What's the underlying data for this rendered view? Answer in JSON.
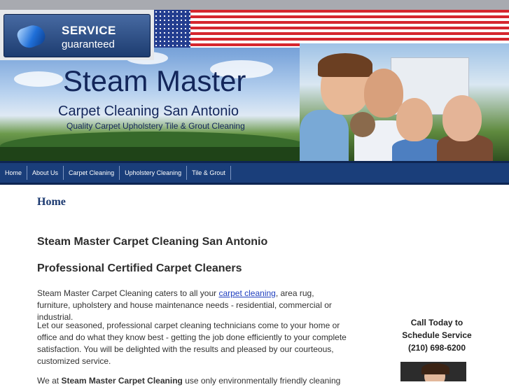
{
  "header": {
    "badge_line1": "SERVICE",
    "badge_line2": "guaranteed",
    "site_title": "Steam Master",
    "site_subtitle": "Carpet Cleaning San Antonio",
    "tagline": "Quality Carpet Upholstery Tile & Grout Cleaning"
  },
  "nav": {
    "items": [
      "Home",
      "About Us",
      "Carpet Cleaning",
      "Upholstery Cleaning",
      "Tile & Grout"
    ]
  },
  "main": {
    "page_heading": "Home",
    "heading1": "Steam Master Carpet Cleaning San Antonio",
    "heading2": "Professional Certified Carpet Cleaners",
    "para1_before": "Steam Master Carpet Cleaning caters to all your ",
    "para1_link": "carpet cleaning",
    "para1_after": ", area rug, furniture, upholstery and house maintenance needs - residential, commercial or industrial.",
    "para2": "Let our seasoned, professional carpet cleaning technicians come to your home or office and do what they know best - getting the job done efficiently to your complete satisfaction. You will be delighted with the results and pleased by our courteous, customized service.",
    "para3_before": "We at ",
    "para3_bold": "Steam Master Carpet Cleaning",
    "para3_after": " use only environmentally friendly cleaning"
  },
  "sidebar": {
    "call_line1": "Call Today to",
    "call_line2": "Schedule Service",
    "phone": "(210) 698-6200"
  },
  "colors": {
    "nav_bg": "#1a3e7a",
    "title_color": "#13265a",
    "link_color": "#1f3fbf"
  }
}
